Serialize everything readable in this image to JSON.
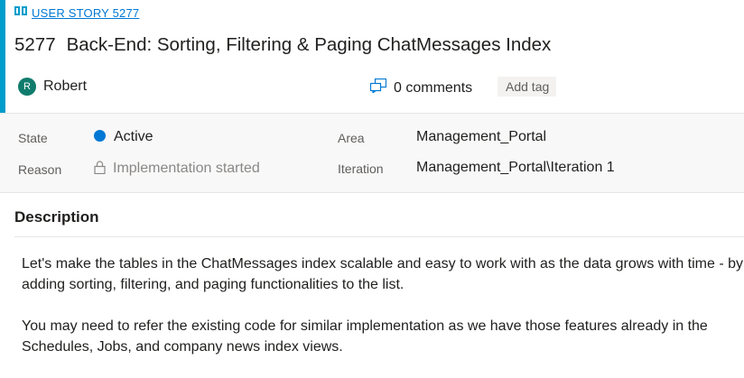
{
  "work_item": {
    "type_label": "USER STORY 5277",
    "id": "5277",
    "title": "Back-End: Sorting, Filtering & Paging ChatMessages Index",
    "assignee": {
      "initial": "R",
      "name": "Robert"
    },
    "comments": "0 comments",
    "add_tag": "Add tag"
  },
  "fields": {
    "state_label": "State",
    "state_value": "Active",
    "reason_label": "Reason",
    "reason_value": "Implementation started",
    "area_label": "Area",
    "area_value": "Management_Portal",
    "iteration_label": "Iteration",
    "iteration_value": "Management_Portal\\Iteration 1"
  },
  "description": {
    "header": "Description",
    "paragraphs": [
      "Let's make the tables in the ChatMessages index scalable and easy to work with as the data grows with time - by adding sorting, filtering, and paging functionalities to the list.",
      "You may need to refer the existing code for similar implementation as we have those features already in the Schedules, Jobs, and company news index views."
    ]
  },
  "colors": {
    "accent": "#009ccc",
    "link": "#0078d4",
    "state_active": "#0078d4",
    "avatar": "#107c6d"
  },
  "icons": {
    "type": "book-icon",
    "comments": "comments-icon",
    "reason": "lock-icon"
  }
}
